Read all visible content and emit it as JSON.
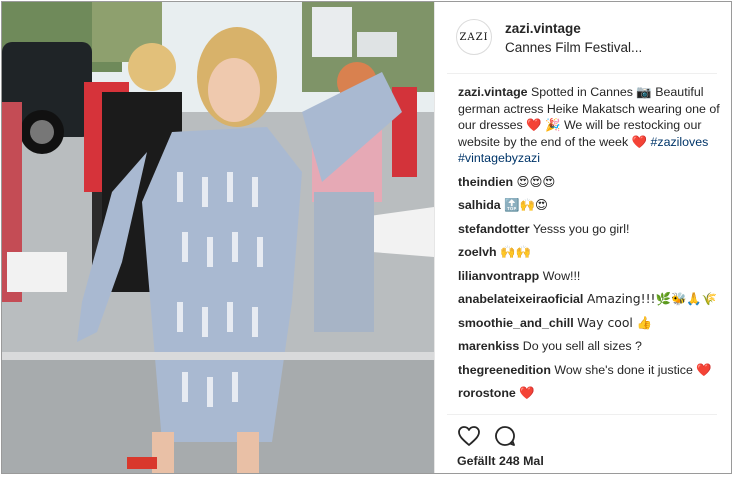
{
  "post": {
    "avatar_text": "ZAZI",
    "username": "zazi.vintage",
    "location": "Cannes Film Festival...",
    "caption": {
      "user": "zazi.vintage",
      "text_1": "Spotted in Cannes 📷 Beautiful german actress Heike Makatsch wearing one of our dresses",
      "text_2": "🎉 We will be restocking our website by the end of the week",
      "hashtags": "#zaziloves #vintagebyzazi"
    },
    "comments": [
      {
        "user": "theindien",
        "text": "😍😍😍"
      },
      {
        "user": "salhida",
        "text": "🔝🙌😍"
      },
      {
        "user": "stefandotter",
        "text": "Yesss you go girl!"
      },
      {
        "user": "zoelvh",
        "text": "🙌🙌"
      },
      {
        "user": "lilianvontrapp",
        "text": "Wow!!!"
      },
      {
        "user": "anabelateixeiraoficial",
        "text": "Amazing!!!🌿🐝🙏🌾"
      },
      {
        "user": "smoothie_and_chill",
        "text": "Way cool 👍"
      },
      {
        "user": "marenkiss",
        "text": "Do you sell all sizes ?"
      },
      {
        "user": "thegreenedition",
        "text": "Wow she's done it justice"
      },
      {
        "user": "rorostone",
        "text": ""
      }
    ],
    "likes": "Gefällt 248 Mal",
    "icons": {
      "like": "heart-outline-icon",
      "comment": "comment-bubble-icon",
      "heart_emoji": "red-heart-emoji"
    },
    "colors": {
      "text": "#262626",
      "hashtag": "#003569",
      "heart": "#e0243a",
      "border": "#dbdbdb"
    }
  }
}
